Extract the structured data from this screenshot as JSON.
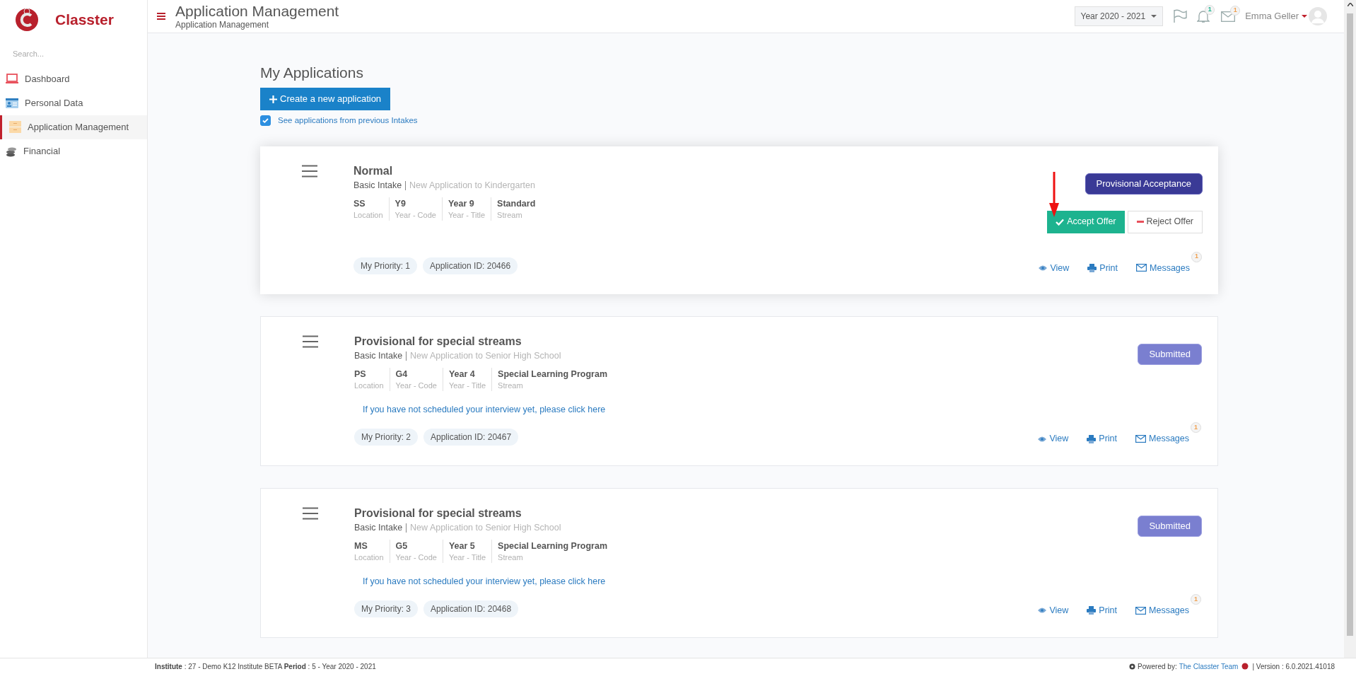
{
  "sidebar": {
    "logo_text": "Classter",
    "search_placeholder": "Search...",
    "items": [
      {
        "label": "Dashboard",
        "selected": false
      },
      {
        "label": "Personal Data",
        "selected": false
      },
      {
        "label": "Application Management",
        "selected": true
      },
      {
        "label": "Financial",
        "selected": false
      }
    ]
  },
  "header": {
    "title": "Application Management",
    "subtitle": "Application Management",
    "year_select": "Year 2020 - 2021",
    "notifications_badge": "1",
    "messages_badge": "1",
    "user_name": "Emma Geller"
  },
  "page": {
    "heading": "My Applications",
    "create_button": "Create a new application",
    "previous_intakes": {
      "label": "See applications from previous Intakes",
      "checked": true
    }
  },
  "applications": [
    {
      "selected": true,
      "title": "Normal",
      "intake": "Basic Intake",
      "description": "New Application to Kindergarten",
      "fields": [
        {
          "value": "SS",
          "label": "Location"
        },
        {
          "value": "Y9",
          "label": "Year - Code"
        },
        {
          "value": "Year 9",
          "label": "Year - Title"
        },
        {
          "value": "Standard",
          "label": "Stream"
        }
      ],
      "status": {
        "label": "Provisional Acceptance",
        "kind": "acceptance"
      },
      "offer": {
        "accept": "Accept Offer",
        "reject": "Reject Offer"
      },
      "priority": "My Priority: 1",
      "application_id": "Application ID: 20466",
      "actions": {
        "view": "View",
        "print": "Print",
        "messages": "Messages",
        "messages_badge": "1"
      }
    },
    {
      "selected": false,
      "title": "Provisional for special streams",
      "intake": "Basic Intake",
      "description": "New Application to Senior High School",
      "fields": [
        {
          "value": "PS",
          "label": "Location"
        },
        {
          "value": "G4",
          "label": "Year - Code"
        },
        {
          "value": "Year 4",
          "label": "Year - Title"
        },
        {
          "value": "Special Learning Program",
          "label": "Stream"
        }
      ],
      "status": {
        "label": "Submitted",
        "kind": "submitted"
      },
      "interview_link": "If you have not scheduled your interview yet, please click here",
      "priority": "My Priority: 2",
      "application_id": "Application ID: 20467",
      "actions": {
        "view": "View",
        "print": "Print",
        "messages": "Messages",
        "messages_badge": "1"
      }
    },
    {
      "selected": false,
      "title": "Provisional for special streams",
      "intake": "Basic Intake",
      "description": "New Application to Senior High School",
      "fields": [
        {
          "value": "MS",
          "label": "Location"
        },
        {
          "value": "G5",
          "label": "Year - Code"
        },
        {
          "value": "Year 5",
          "label": "Year - Title"
        },
        {
          "value": "Special Learning Program",
          "label": "Stream"
        }
      ],
      "status": {
        "label": "Submitted",
        "kind": "submitted"
      },
      "interview_link": "If you have not scheduled your interview yet, please click here",
      "priority": "My Priority: 3",
      "application_id": "Application ID: 20468",
      "actions": {
        "view": "View",
        "print": "Print",
        "messages": "Messages",
        "messages_badge": "1"
      }
    }
  ],
  "footer": {
    "info": "**Institute** : 27 - Demo K12 Institute BETA **Period** : 5 - Year 2020 - 2021",
    "powered_by": "Powered by:",
    "team_link": "The Classter Team",
    "version": "| Version : 6.0.2021.41018"
  }
}
